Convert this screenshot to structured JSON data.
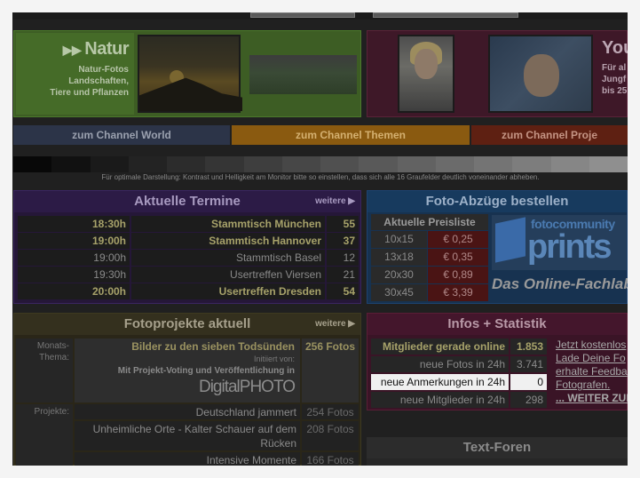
{
  "natur": {
    "title_arrows": "▶▶",
    "title": "Natur",
    "desc": [
      "Natur-Fotos",
      "Landschaften,",
      "Tiere und Pflanzen"
    ]
  },
  "you": {
    "title": "You",
    "desc": [
      "Für al",
      "Jungf",
      "bis 25"
    ]
  },
  "channels": {
    "world": "zum Channel World",
    "themen": "zum Channel Themen",
    "projekte": "zum Channel Proje"
  },
  "grayscale_note": "Für optimale Darstellung: Kontrast und Helligkeit am Monitor bitte so einstellen, dass sich alle 16 Graufelder deutlich voneinander abheben.",
  "termine": {
    "title": "Aktuelle Termine",
    "more": "weitere ▶",
    "rows": [
      {
        "time": "18:30h",
        "place": "Stammtisch München",
        "count": "55",
        "highlight": true
      },
      {
        "time": "19:00h",
        "place": "Stammtisch Hannover",
        "count": "37",
        "highlight": true
      },
      {
        "time": "19:00h",
        "place": "Stammtisch Basel",
        "count": "12",
        "highlight": false
      },
      {
        "time": "19:30h",
        "place": "Usertreffen Viersen",
        "count": "21",
        "highlight": false
      },
      {
        "time": "20:00h",
        "place": "Usertreffen Dresden",
        "count": "54",
        "highlight": true
      }
    ]
  },
  "abzuege": {
    "title": "Foto-Abzüge bestellen",
    "price_header": "Aktuelle Preisliste",
    "prices": [
      {
        "size": "10x15",
        "price": "€ 0,25"
      },
      {
        "size": "13x18",
        "price": "€ 0,35"
      },
      {
        "size": "20x30",
        "price": "€ 0,89"
      },
      {
        "size": "30x45",
        "price": "€ 3,39"
      }
    ],
    "logo_top": "fotocommunity",
    "logo_main": "prints",
    "tagline": "Das Online-Fachlab"
  },
  "fotoprojekte": {
    "title": "Fotoprojekte aktuell",
    "more": "weitere ▶",
    "label_monat": "Monats-",
    "label_thema": "Thema:",
    "label_projekte": "Projekte:",
    "feature_title": "Bilder zu den sieben Todsünden",
    "feature_count": "256 Fotos",
    "feature_init": "Initiiert von:",
    "feature_sub": "Mit Projekt-Voting und Veröffentlichung in",
    "feature_logo_a": "Digital",
    "feature_logo_b": "PHOTO",
    "projects": [
      {
        "name": "Deutschland jammert",
        "count": "254 Fotos"
      },
      {
        "name": "Unheimliche Orte - Kalter Schauer auf dem Rücken",
        "count": "208 Fotos"
      },
      {
        "name": "Intensive Momente",
        "count": "166 Fotos"
      }
    ]
  },
  "infos": {
    "title": "Infos + Statistik",
    "rows": [
      {
        "label": "Mitglieder gerade online",
        "value": "1.853",
        "style": "bold"
      },
      {
        "label": "neue Fotos in 24h",
        "value": "3.741",
        "style": "normal"
      },
      {
        "label": "neue Anmerkungen in 24h",
        "value": "0",
        "style": "highlight"
      },
      {
        "label": "neue Mitglieder in 24h",
        "value": "298",
        "style": "normal"
      }
    ],
    "links": [
      "Jetzt kostenlos",
      "Lade Deine Fo",
      "erhalte Feedba",
      "Fotografen."
    ],
    "links_more": "... WEITER ZUR"
  },
  "foren": {
    "title": "Text-Foren"
  },
  "colors": {
    "natur_bg": "#3d5d24",
    "you_bg": "#3e1828",
    "termine_bg": "#251738",
    "abzuege_bg": "#173250",
    "foto_bg": "#2a2618",
    "infos_bg": "#3a1426",
    "highlight_row": "#f0f0f0"
  }
}
